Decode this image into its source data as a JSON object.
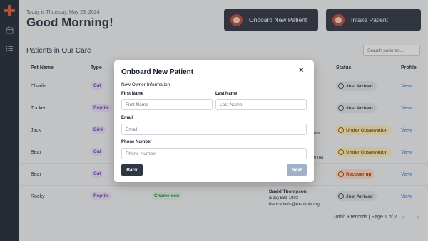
{
  "sidebar": {
    "items": [
      {
        "icon": "calendar-icon"
      },
      {
        "icon": "list-icon"
      }
    ]
  },
  "header": {
    "date_text": "Today is Thursday, May 23, 2024",
    "greeting": "Good Morning!",
    "onboard_button": "Onboard New Patient",
    "intake_button": "Intake Patient"
  },
  "patients": {
    "title": "Patients in Our Care",
    "search_placeholder": "Search patients...",
    "columns": [
      "Pet Name",
      "Type",
      "Status",
      "Profile"
    ],
    "rows": [
      {
        "name": "Charlie",
        "type": "Cat",
        "status": "Just Arrived",
        "profile": "View"
      },
      {
        "name": "Tucker",
        "type": "Reptile",
        "status": "Just Arrived",
        "profile": "View"
      },
      {
        "name": "Jack",
        "type": "Bird",
        "status": "Under Observation",
        "profile": "View",
        "frag": "om"
      },
      {
        "name": "Bear",
        "type": "Cat",
        "status": "Under Observation",
        "profile": "View",
        "frag": "e.net"
      },
      {
        "name": "Bear",
        "type": "Cat",
        "status": "Recovering",
        "profile": "View"
      },
      {
        "name": "Rocky",
        "type": "Reptile",
        "breed": "Chameleon",
        "status": "Just Arrived",
        "profile": "View",
        "owner_name": "David Thompson",
        "owner_phone": "(513) 581-1893",
        "owner_email": "biancadavis@example.org"
      }
    ],
    "footer": "Total: 9 records  |  Page 1 of 2",
    "prev": "‹",
    "next": "›"
  },
  "modal": {
    "title": "Onboard New Patient",
    "close": "×",
    "subtitle": "New Owner Information",
    "first_name_label": "First Name",
    "first_name_placeholder": "First Name",
    "last_name_label": "Last Name",
    "last_name_placeholder": "Last Name",
    "email_label": "Email",
    "email_placeholder": "Email",
    "phone_label": "Phone Number",
    "phone_placeholder": "Phone Number",
    "back_button": "Back",
    "next_button": "Next"
  },
  "colors": {
    "sidebar": "#2f3744",
    "accent": "#e0654a",
    "link": "#3b82f6"
  }
}
